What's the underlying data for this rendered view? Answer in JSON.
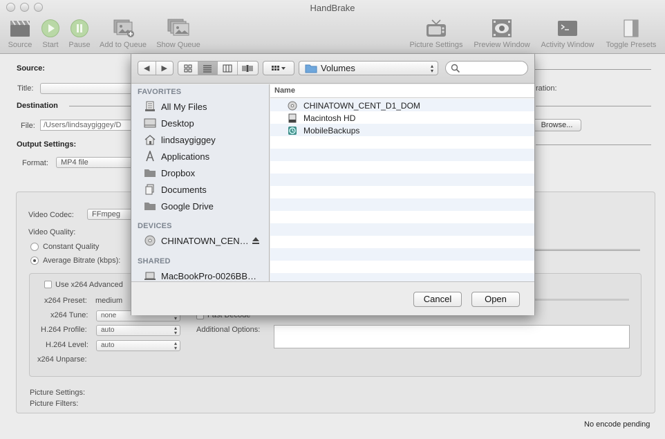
{
  "window": {
    "title": "HandBrake"
  },
  "toolbar": {
    "items": [
      {
        "label": "Source",
        "icon": "clapperboard-icon"
      },
      {
        "label": "Start",
        "icon": "play-icon"
      },
      {
        "label": "Pause",
        "icon": "pause-icon"
      },
      {
        "label": "Add to Queue",
        "icon": "add-to-queue-icon"
      },
      {
        "label": "Show Queue",
        "icon": "show-queue-icon"
      },
      {
        "label": "Picture Settings",
        "icon": "tv-icon"
      },
      {
        "label": "Preview Window",
        "icon": "eye-film-icon"
      },
      {
        "label": "Activity Window",
        "icon": "terminal-icon"
      },
      {
        "label": "Toggle Presets",
        "icon": "drawer-icon"
      }
    ]
  },
  "main": {
    "source_label": "Source:",
    "title_label": "Title:",
    "duration_label": "ration:",
    "destination_label": "Destination",
    "file_label": "File:",
    "file_value": "/Users/lindsaygiggey/D",
    "browse_label": "Browse...",
    "output_label": "Output Settings:",
    "format_label": "Format:",
    "format_value": "MP4 file",
    "video_codec_label": "Video Codec:",
    "video_codec_value": "FFmpeg",
    "video_quality_label": "Video Quality:",
    "constant_quality_label": "Constant Quality",
    "average_bitrate_label": "Average Bitrate (kbps):",
    "use_x264_label": "Use x264 Advanced",
    "x264_preset_label": "x264 Preset:",
    "x264_preset_value": "medium",
    "x264_tune_label": "x264 Tune:",
    "x264_tune_value": "none",
    "fast_decode_label": "Fast Decode",
    "h264_profile_label": "H.264 Profile:",
    "h264_profile_value": "auto",
    "additional_options_label": "Additional Options:",
    "h264_level_label": "H.264 Level:",
    "h264_level_value": "auto",
    "x264_unparse_label": "x264 Unparse:",
    "picture_settings_label": "Picture Settings:",
    "picture_filters_label": "Picture Filters:",
    "status": "No encode pending"
  },
  "dialog": {
    "location": "Volumes",
    "search_placeholder": "",
    "favorites_header": "FAVORITES",
    "favorites": [
      {
        "label": "All My Files",
        "icon": "all-files-icon"
      },
      {
        "label": "Desktop",
        "icon": "desktop-icon"
      },
      {
        "label": "lindsaygiggey",
        "icon": "home-icon"
      },
      {
        "label": "Applications",
        "icon": "applications-icon"
      },
      {
        "label": "Dropbox",
        "icon": "folder-icon"
      },
      {
        "label": "Documents",
        "icon": "documents-icon"
      },
      {
        "label": "Google Drive",
        "icon": "folder-icon"
      }
    ],
    "devices_header": "DEVICES",
    "devices": [
      {
        "label": "CHINATOWN_CEN…",
        "icon": "dvd-icon"
      }
    ],
    "shared_header": "SHARED",
    "shared": [
      {
        "label": "MacBookPro-0026BB…",
        "icon": "laptop-icon"
      }
    ],
    "column_name": "Name",
    "files": [
      {
        "name": "CHINATOWN_CENT_D1_DOM",
        "icon": "dvd-icon"
      },
      {
        "name": "Macintosh HD",
        "icon": "hard-drive-icon"
      },
      {
        "name": "MobileBackups",
        "icon": "time-machine-icon"
      }
    ],
    "cancel_label": "Cancel",
    "open_label": "Open"
  }
}
